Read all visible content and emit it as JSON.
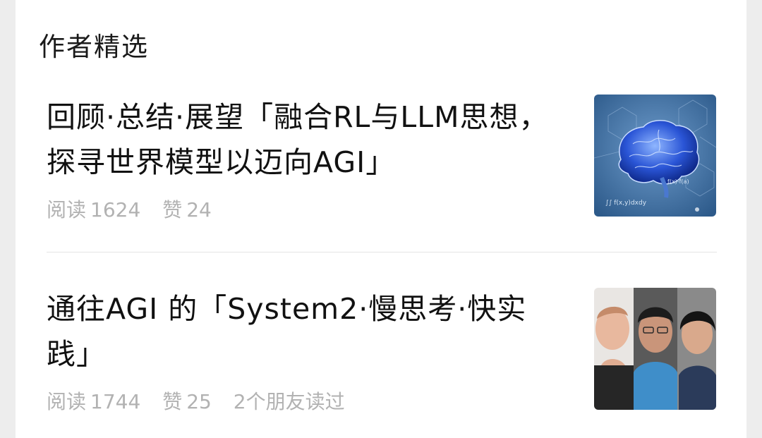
{
  "section": {
    "title": "作者精选"
  },
  "articles": [
    {
      "title": "回顾·总结·展望「融合RL与LLM思想，探寻世界模型以迈向AGI」",
      "read_label": "阅读",
      "read_count": "1624",
      "like_label": "赞",
      "like_count": "24",
      "friends": "",
      "thumb_icon": "brain-thumbnail-icon"
    },
    {
      "title": "通往AGI 的「System2·慢思考·快实践」",
      "read_label": "阅读",
      "read_count": "1744",
      "like_label": "赞",
      "like_count": "25",
      "friends": "2个朋友读过",
      "thumb_icon": "portraits-thumbnail-icon"
    }
  ]
}
